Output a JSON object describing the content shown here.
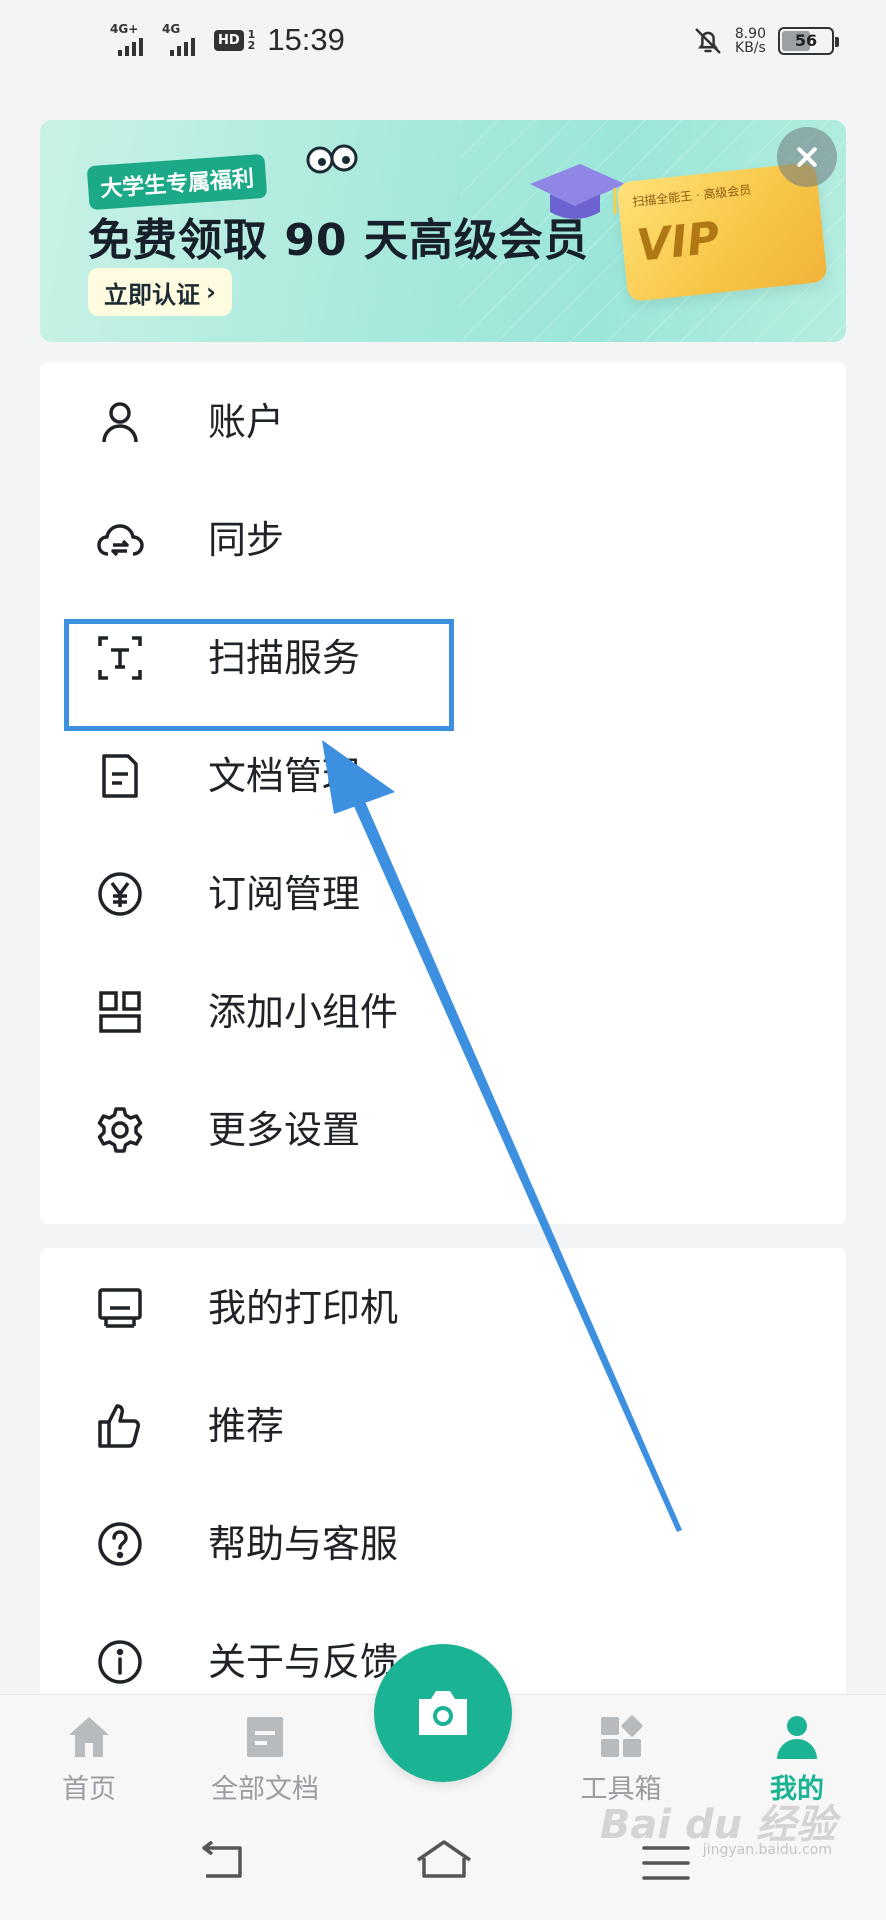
{
  "status_bar": {
    "signal1_label": "4G+",
    "signal2_label": "4G",
    "hd_label": "HD",
    "hd_sub_top": "1",
    "hd_sub_bottom": "2",
    "time": "15:39",
    "net_speed_value": "8.90",
    "net_speed_unit": "KB/s",
    "battery_percent": "56"
  },
  "banner": {
    "tag": "大学生专属福利",
    "title": "免费领取 90 天高级会员",
    "cta_label": "立即认证",
    "cta_chevron": "›",
    "vip_card_caption": "扫描全能王 · 高级会员",
    "vip_card_label": "VIP",
    "accent_color": "#1ca987"
  },
  "menu_group_1": [
    {
      "label": "账户",
      "icon": "user-icon"
    },
    {
      "label": "同步",
      "icon": "cloud-sync-icon"
    },
    {
      "label": "扫描服务",
      "icon": "text-scan-icon"
    },
    {
      "label": "文档管理",
      "icon": "document-icon"
    },
    {
      "label": "订阅管理",
      "icon": "yen-circle-icon"
    },
    {
      "label": "添加小组件",
      "icon": "widget-icon"
    },
    {
      "label": "更多设置",
      "icon": "gear-icon"
    }
  ],
  "menu_group_2": [
    {
      "label": "我的打印机",
      "icon": "printer-icon"
    },
    {
      "label": "推荐",
      "icon": "thumbs-up-icon"
    },
    {
      "label": "帮助与客服",
      "icon": "help-icon"
    },
    {
      "label": "关于与反馈",
      "icon": "info-icon"
    }
  ],
  "tab_bar": {
    "tabs": [
      {
        "label": "首页",
        "icon": "home-icon"
      },
      {
        "label": "全部文档",
        "icon": "documents-icon"
      },
      {
        "label": "工具箱",
        "icon": "toolbox-icon"
      },
      {
        "label": "我的",
        "icon": "profile-icon",
        "active": true
      }
    ],
    "camera_icon": "camera-icon",
    "active_color": "#1ab394",
    "inactive_color": "#9a9ea2"
  },
  "annotation": {
    "highlight_color": "#3d8fe0"
  },
  "watermark": {
    "text": "Bai du 经验",
    "sub": "jingyan.baidu.com"
  }
}
